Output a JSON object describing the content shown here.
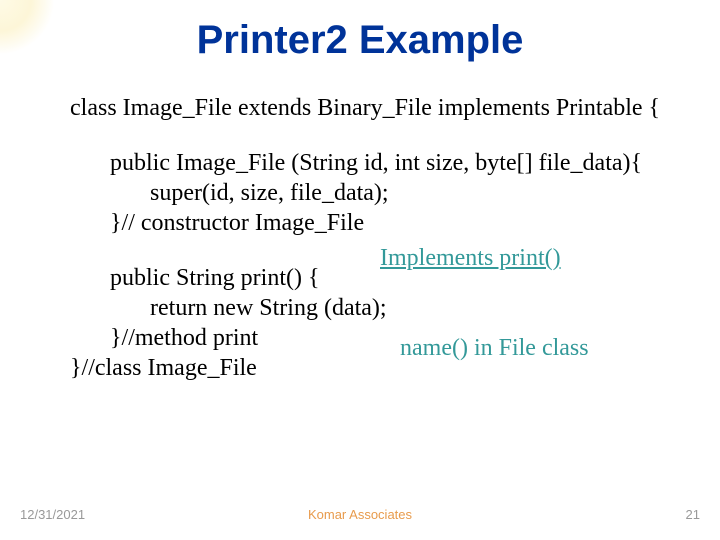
{
  "title": "Printer2 Example",
  "code": {
    "line1": "class Image_File extends Binary_File implements Printable {",
    "block2_l1": "public Image_File (String id, int size, byte[] file_data){",
    "block2_l2": "super(id, size, file_data);",
    "block2_l3": "}// constructor Image_File",
    "block3_l1": "public String print() {",
    "block3_l2": "return new String (data);",
    "block3_l3": "}//method print",
    "block3_l4": "}//class Image_File"
  },
  "annotations": {
    "a1": "Implements print()",
    "a2": "name() in File class"
  },
  "footer": {
    "date": "12/31/2021",
    "org": "Komar Associates",
    "page": "21"
  }
}
